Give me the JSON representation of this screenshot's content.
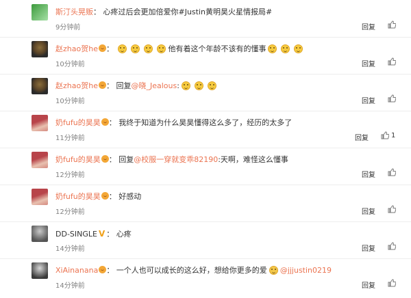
{
  "labels": {
    "reply": "回复"
  },
  "comments": [
    {
      "user": "斯汀头晃贩",
      "separator": "：",
      "text": "心疼过后会更加倍爱你#Justin黄明昊火星情报局#",
      "time": "9分钟前",
      "avatar_colors": [
        "#3c9a3c",
        "#a6e0a6"
      ]
    },
    {
      "user": "赵zhao贺he",
      "separator": "：",
      "text_before": "",
      "text_after": "他有着这个年龄不该有的懂事",
      "time": "10分钟前",
      "avatar_colors": [
        "#8a6d3b",
        "#2b2b2b"
      ]
    },
    {
      "user": "赵zhao贺he",
      "separator": "：",
      "reply_prefix": "回复",
      "mention": "@晓_Jealous",
      "colon": ":",
      "time": "10分钟前",
      "avatar_colors": [
        "#8a6d3b",
        "#2b2b2b"
      ]
    },
    {
      "user": "奶fufu的昊昊",
      "separator": "：",
      "text": "我终于知道为什么昊昊懂得这么多了，经历的太多了",
      "time": "11分钟前",
      "like_count": "1",
      "avatar_colors": [
        "#b8444a",
        "#e8c1b0"
      ]
    },
    {
      "user": "奶fufu的昊昊",
      "separator": "：",
      "reply_prefix": "回复",
      "mention": "@校服一穿就变乖82190",
      "text": ":天啊，难怪这么懂事",
      "time": "12分钟前",
      "avatar_colors": [
        "#b8444a",
        "#e8c1b0"
      ]
    },
    {
      "user": "奶fufu的昊昊",
      "separator": "：",
      "text": "好感动",
      "time": "12分钟前",
      "avatar_colors": [
        "#b8444a",
        "#e8c1b0"
      ]
    },
    {
      "user": "DD-SINGLE",
      "badge": "V",
      "separator": "：",
      "text": "心疼",
      "time": "14分钟前",
      "avatar_colors": [
        "#555555",
        "#c9c9c9"
      ]
    },
    {
      "user": "XiAinanana",
      "separator": "：",
      "text": "一个人也可以成长的这么好，想给你更多的爱",
      "mention": "@jjjustin0219",
      "time": "14分钟前",
      "avatar_colors": [
        "#3a3a3a",
        "#d9d9d9"
      ]
    }
  ]
}
